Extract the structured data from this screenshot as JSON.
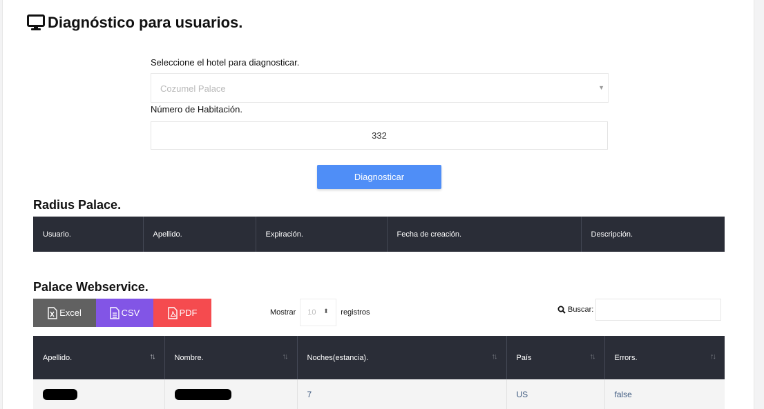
{
  "page": {
    "title": "Diagnóstico para usuarios."
  },
  "form": {
    "hotel_label": "Seleccione el hotel para diagnosticar.",
    "hotel_value": "Cozumel Palace",
    "room_label": "Número de Habitación.",
    "room_value": "332",
    "submit_label": "Diagnosticar"
  },
  "radius": {
    "title": "Radius Palace.",
    "columns": [
      "Usuario.",
      "Apellido.",
      "Expiración.",
      "Fecha de creación.",
      "Descripción."
    ]
  },
  "webservice": {
    "title": "Palace Webservice.",
    "export": {
      "excel": "Excel",
      "csv": "CSV",
      "pdf": "PDF"
    },
    "length": {
      "prefix": "Mostrar",
      "value": "10",
      "suffix": "registros"
    },
    "search_label": "Buscar:",
    "columns": [
      "Apellido.",
      "Nombre.",
      "Noches(estancia).",
      "País",
      "Errors."
    ],
    "rows": [
      {
        "apellido": "",
        "nombre": "",
        "noches": "7",
        "pais": "US",
        "errors": "false"
      }
    ]
  },
  "colors": {
    "header_dark": "#2a2d37",
    "primary": "#4f8ef7",
    "excel": "#616161",
    "csv": "#8255e6",
    "pdf": "#f54b4f"
  },
  "icons": [
    "monitor-icon",
    "caret-down-icon",
    "excel-file-icon",
    "csv-file-icon",
    "pdf-file-icon",
    "sort-icon",
    "search-icon"
  ]
}
